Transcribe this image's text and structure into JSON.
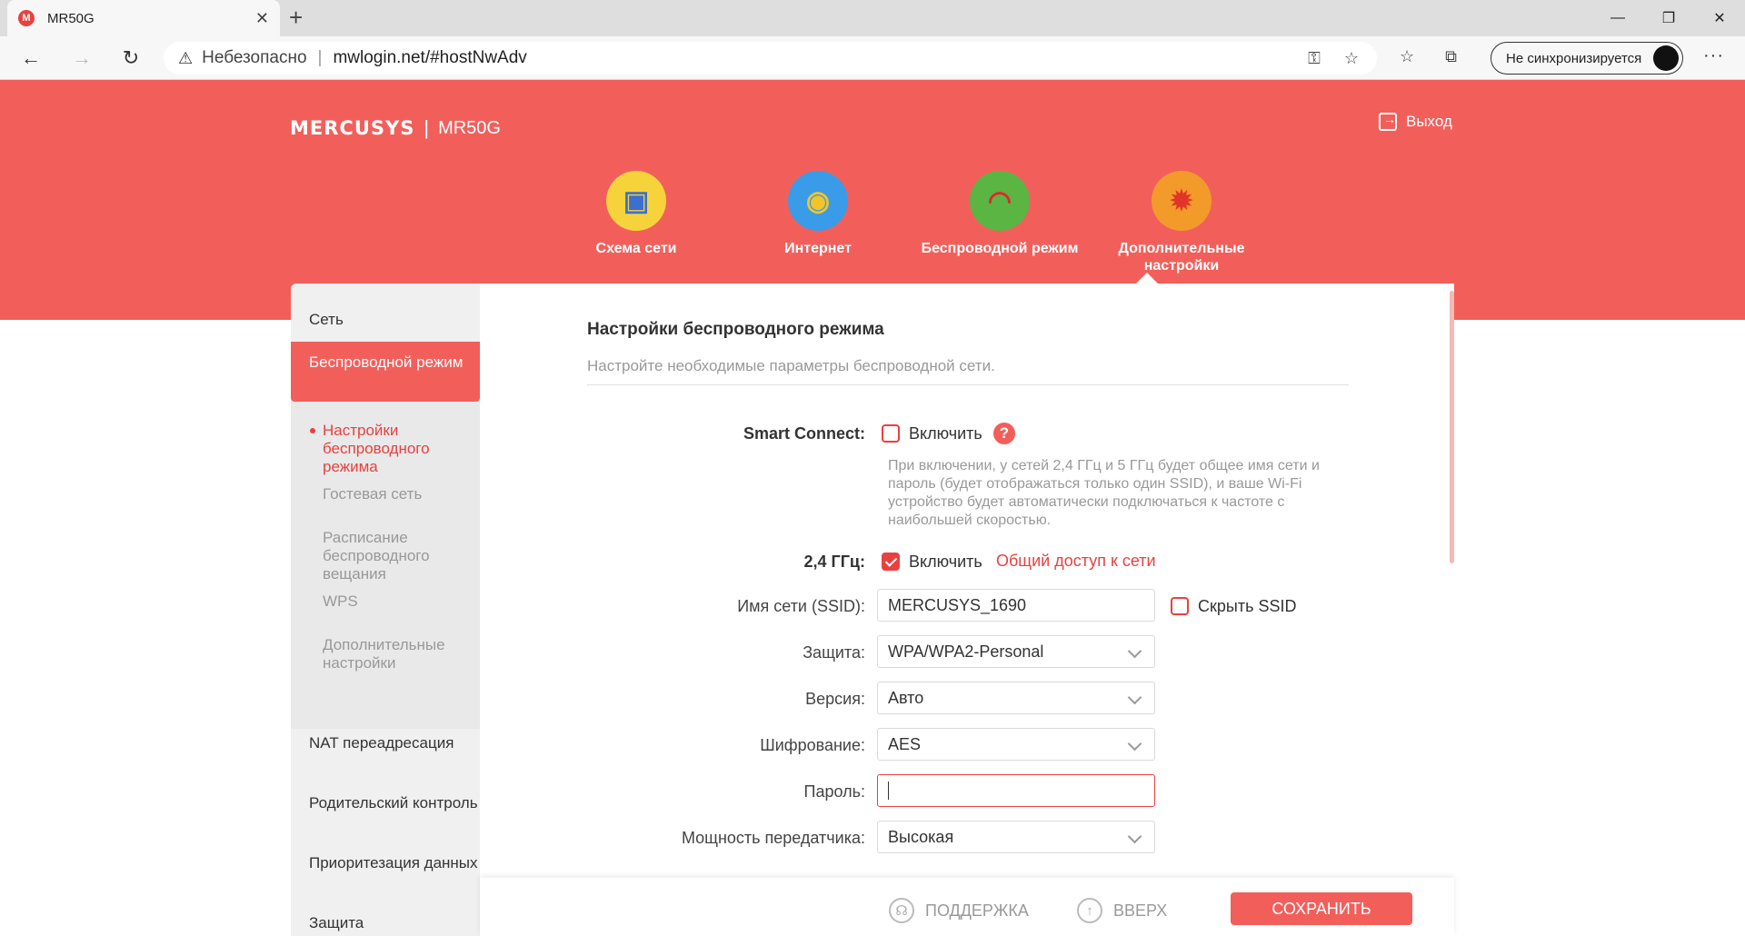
{
  "browser": {
    "tab_title": "MR50G",
    "favicon_letter": "M",
    "url_insecure": "Небезопасно",
    "url": "mwlogin.net/#hostNwAdv",
    "sync_label": "Не синхронизируется"
  },
  "header": {
    "brand": "MERCUSYS",
    "model": "MR50G",
    "logout": "Выход",
    "nav": [
      {
        "label": "Схема сети",
        "icon": "network-map-icon"
      },
      {
        "label": "Интернет",
        "icon": "internet-planet-icon"
      },
      {
        "label": "Беспроводной режим",
        "icon": "wifi-icon"
      },
      {
        "label": "Дополнительные настройки",
        "icon": "advanced-gear-icon"
      }
    ]
  },
  "sidebar": {
    "network": "Сеть",
    "wireless": "Беспроводной режим",
    "sub": {
      "settings": "Настройки беспроводного режима",
      "guest": "Гостевая сеть",
      "schedule": "Расписание беспроводного вещания",
      "wps": "WPS",
      "advanced": "Дополнительные настройки"
    },
    "nat": "NAT переадресация",
    "parental": "Родительский контроль",
    "qos": "Приоритезация данных",
    "security": "Защита"
  },
  "form": {
    "title": "Настройки беспроводного режима",
    "description": "Настройте необходимые параметры беспроводной сети.",
    "smart_connect_label": "Smart Connect:",
    "enable": "Включить",
    "smart_connect_hint": "При включении, у сетей 2,4 ГГц и 5 ГГц будет общее имя сети и пароль (будет отображаться только один SSID), и ваше Wi-Fi устройство будет автоматически подключаться к частоте с наибольшей скоростью.",
    "band_24_label": "2,4 ГГц:",
    "share_link": "Общий доступ к сети",
    "ssid_label": "Имя сети (SSID):",
    "ssid_value": "MERCUSYS_1690",
    "hide_ssid": "Скрыть SSID",
    "security_label": "Защита:",
    "security_value": "WPA/WPA2-Personal",
    "version_label": "Версия:",
    "version_value": "Авто",
    "encryption_label": "Шифрование:",
    "encryption_value": "AES",
    "password_label": "Пароль:",
    "password_value": "",
    "power_label": "Мощность передатчика:",
    "power_value": "Высокая"
  },
  "footer": {
    "support": "ПОДДЕРЖКА",
    "top": "ВВЕРХ",
    "save": "СОХРАНИТЬ"
  },
  "colors": {
    "brand_red": "#f25f5b",
    "accent_red": "#e8413f"
  }
}
